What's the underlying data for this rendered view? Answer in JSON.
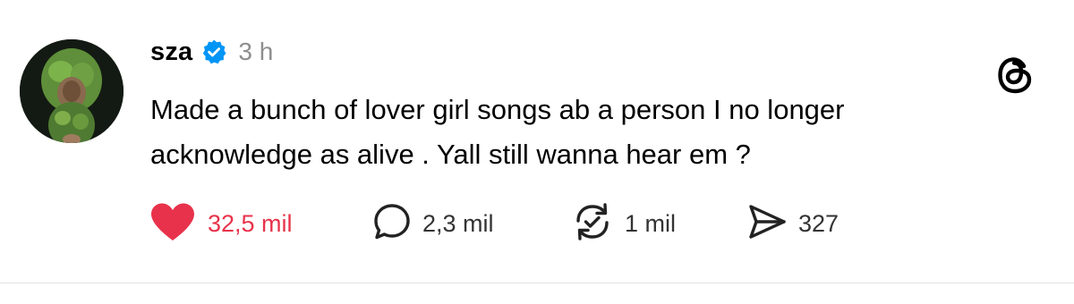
{
  "post": {
    "username": "sza",
    "timestamp": "3 h",
    "text_lines": [
      "Made a bunch of lover girl songs ab a person I no longer",
      "acknowledge as alive . Yall still wanna hear em ?"
    ],
    "avatar_icon": "profile-photo",
    "verified_icon": "verified-badge-icon",
    "app_icon": "threads-logo-icon"
  },
  "actions": {
    "likes": "32,5 mil",
    "replies": "2,3 mil",
    "reposts": "1 mil",
    "shares": "327"
  },
  "colors": {
    "like_red": "#e8324b",
    "verified_blue": "#0095f6",
    "muted_gray": "#8e8e8e"
  }
}
